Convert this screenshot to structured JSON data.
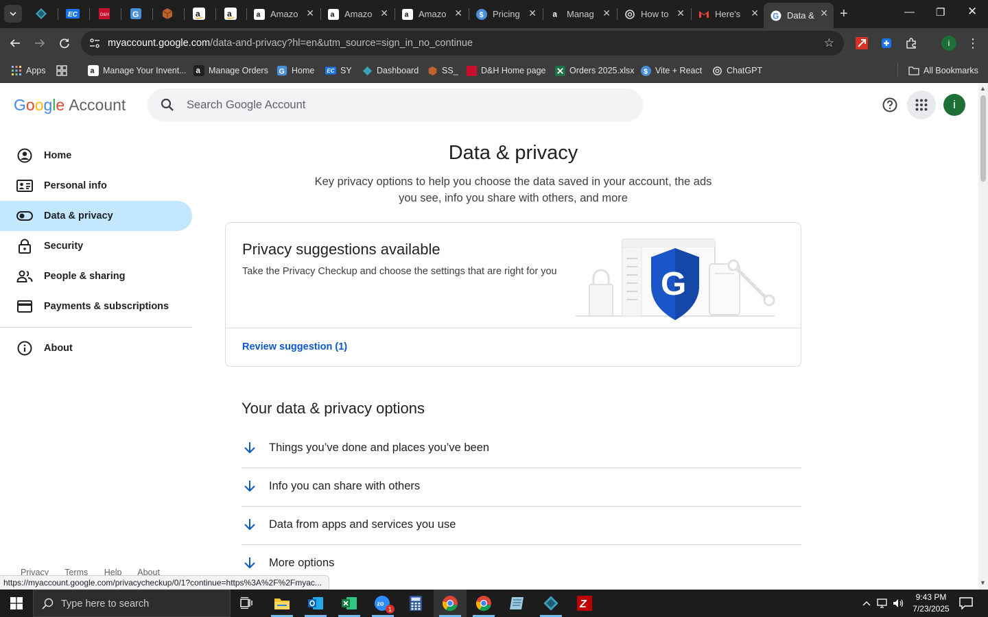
{
  "browser": {
    "tabs": [
      {
        "title": "Amazo",
        "favicon": "amazon-icon"
      },
      {
        "title": "Amazo",
        "favicon": "amazon-icon"
      },
      {
        "title": "Amazo",
        "favicon": "amazon-icon"
      },
      {
        "title": "Pricing",
        "favicon": "dollar-icon"
      },
      {
        "title": "Manag",
        "favicon": "amazon-icon"
      },
      {
        "title": "How to",
        "favicon": "openai-icon"
      },
      {
        "title": "Here's",
        "favicon": "gmail-icon"
      },
      {
        "title": "Data &",
        "favicon": "google-icon",
        "active": true
      }
    ],
    "url_domain": "myaccount.google.com",
    "url_path": "/data-and-privacy?hl=en&utm_source=sign_in_no_continue",
    "profile_initial": "i",
    "bookmarks": [
      {
        "label": "Apps"
      },
      {
        "label": "Manage Your Invent..."
      },
      {
        "label": "Manage Orders"
      },
      {
        "label": "Home"
      },
      {
        "label": "SY"
      },
      {
        "label": "Dashboard"
      },
      {
        "label": "SS_"
      },
      {
        "label": "D&H Home page"
      },
      {
        "label": "Orders 2025.xlsx"
      },
      {
        "label": "Vite + React"
      },
      {
        "label": "ChatGPT"
      },
      {
        "label": "All Bookmarks"
      }
    ]
  },
  "header": {
    "logo_google": [
      "G",
      "o",
      "o",
      "g",
      "l",
      "e"
    ],
    "logo_account": "Account",
    "search_placeholder": "Search Google Account",
    "avatar_initial": "i"
  },
  "nav": {
    "items": [
      {
        "label": "Home",
        "icon": "account-circle-icon"
      },
      {
        "label": "Personal info",
        "icon": "id-card-icon"
      },
      {
        "label": "Data & privacy",
        "icon": "toggle-icon",
        "selected": true
      },
      {
        "label": "Security",
        "icon": "lock-icon"
      },
      {
        "label": "People & sharing",
        "icon": "people-icon"
      },
      {
        "label": "Payments & subscriptions",
        "icon": "credit-card-icon"
      }
    ],
    "about": {
      "label": "About",
      "icon": "info-icon"
    },
    "footer": [
      "Privacy",
      "Terms",
      "Help",
      "About"
    ]
  },
  "main": {
    "title": "Data & privacy",
    "subtitle": "Key privacy options to help you choose the data saved in your account, the ads you see, info you share with others, and more",
    "suggestion_card": {
      "title": "Privacy suggestions available",
      "description": "Take the Privacy Checkup and choose the settings that are right for you",
      "link": "Review suggestion (1)"
    },
    "options_title": "Your data & privacy options",
    "options": [
      "Things you’ve done and places you’ve been",
      "Info you can share with others",
      "Data from apps and services you use",
      "More options"
    ]
  },
  "status_url": "https://myaccount.google.com/privacycheckup/0/1?continue=https%3A%2F%2Fmyac...",
  "taskbar": {
    "search_placeholder": "Type here to search",
    "time": "9:43 PM",
    "date": "7/23/2025",
    "zoom_badge": "1"
  },
  "colors": {
    "accent": "#0b57d0",
    "nav_selected": "#c2e7ff",
    "avatar": "#1e6f36"
  }
}
